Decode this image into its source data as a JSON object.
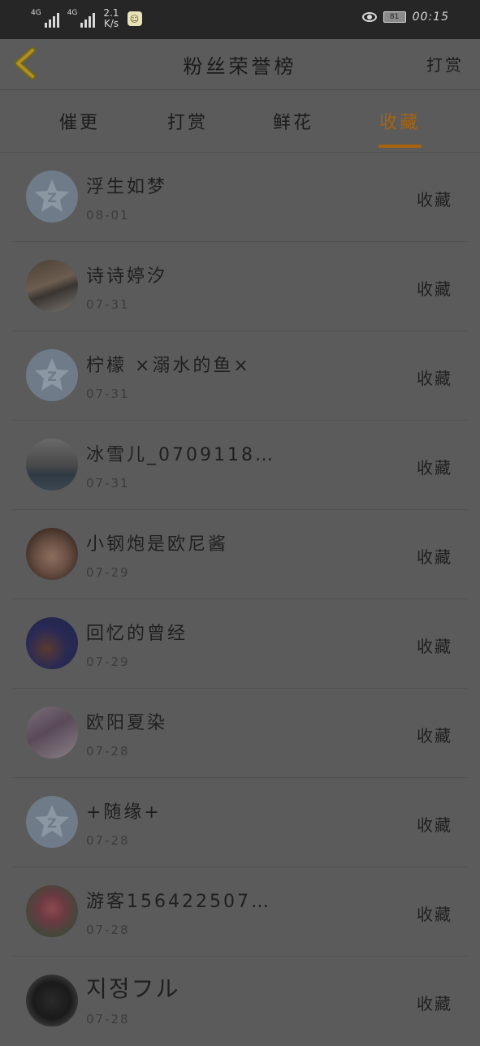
{
  "status_bar": {
    "net1": "4G",
    "net2": "4G",
    "speed_value": "2.1",
    "speed_unit": "K/s",
    "battery": "81",
    "time": "00:15"
  },
  "nav": {
    "title": "粉丝荣誉榜",
    "action": "打赏"
  },
  "tabs": [
    {
      "label": "催更"
    },
    {
      "label": "打赏"
    },
    {
      "label": "鲜花"
    },
    {
      "label": "收藏"
    }
  ],
  "active_tab": "收藏",
  "colors": {
    "accent": "#a8640f"
  },
  "list": [
    {
      "name": "浮生如梦",
      "date": "08-01",
      "label": "收藏",
      "avatar": "default"
    },
    {
      "name": "诗诗婷汐",
      "date": "07-31",
      "label": "收藏",
      "avatar": "photo"
    },
    {
      "name": "柠檬 ×溺水的鱼×",
      "date": "07-31",
      "label": "收藏",
      "avatar": "default"
    },
    {
      "name": "冰雪儿_0709118…",
      "date": "07-31",
      "label": "收藏",
      "avatar": "photo"
    },
    {
      "name": "小钢炮是欧尼酱",
      "date": "07-29",
      "label": "收藏",
      "avatar": "photo"
    },
    {
      "name": "回忆的曾经",
      "date": "07-29",
      "label": "收藏",
      "avatar": "photo"
    },
    {
      "name": "欧阳夏染",
      "date": "07-28",
      "label": "收藏",
      "avatar": "photo"
    },
    {
      "name": "+随缘+",
      "date": "07-28",
      "label": "收藏",
      "avatar": "default"
    },
    {
      "name": "游客156422507…",
      "date": "07-28",
      "label": "收藏",
      "avatar": "photo"
    },
    {
      "name": "지정フル",
      "date": "07-28",
      "label": "收藏",
      "avatar": "photo"
    }
  ]
}
